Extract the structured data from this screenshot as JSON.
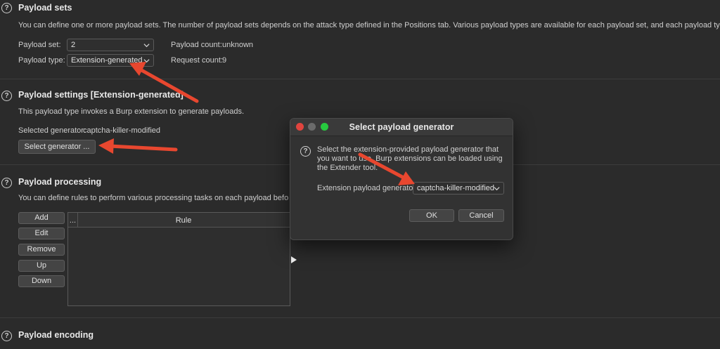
{
  "payload_sets": {
    "title": "Payload sets",
    "description": "You can define one or more payload sets. The number of payload sets depends on the attack type defined in the Positions tab. Various payload types are available for each payload set, and each payload type can be customized in different ways.",
    "payload_set_label": "Payload set:",
    "payload_set_value": "2",
    "payload_type_label": "Payload type:",
    "payload_type_value": "Extension-generated",
    "payload_count_label": "Payload count:",
    "payload_count_value": "unknown",
    "request_count_label": "Request count:",
    "request_count_value": "9"
  },
  "payload_settings": {
    "title": "Payload settings [Extension-generated]",
    "description": "This payload type invokes a Burp extension to generate payloads.",
    "selected_generator_label": "Selected generator:",
    "selected_generator_value": "captcha-killer-modified",
    "select_button": "Select generator ..."
  },
  "payload_processing": {
    "title": "Payload processing",
    "description": "You can define rules to perform various processing tasks on each payload before it is used.",
    "buttons": {
      "add": "Add",
      "edit": "Edit",
      "remove": "Remove",
      "up": "Up",
      "down": "Down"
    },
    "table": {
      "col_dots": "...",
      "col_rule": "Rule"
    }
  },
  "payload_encoding": {
    "title": "Payload encoding"
  },
  "dialog": {
    "title": "Select payload generator",
    "text": "Select the extension-provided payload generator that you want to use. Burp extensions can be loaded using the Extender tool.",
    "generator_label": "Extension payload generator:",
    "generator_value": "captcha-killer-modified",
    "ok": "OK",
    "cancel": "Cancel"
  },
  "colors": {
    "background": "#2b2b2b",
    "annotation_arrow": "#e8472f",
    "traffic_close": "#e0443e",
    "traffic_zoom": "#27c93f"
  }
}
